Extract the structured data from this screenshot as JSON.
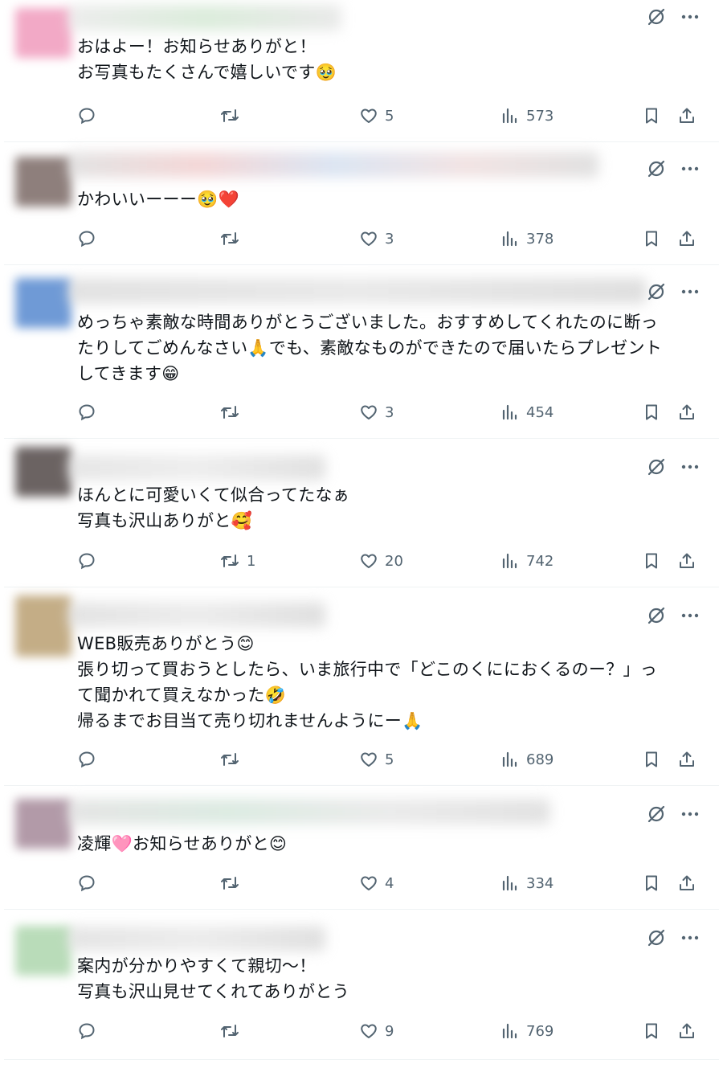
{
  "colors": {
    "icon": "#536471",
    "text": "#0f1419",
    "divider": "#eff3f4"
  },
  "icons": {
    "reply": "reply-icon",
    "repost": "repost-icon",
    "like": "heart-icon",
    "views": "views-icon",
    "bookmark": "bookmark-icon",
    "share": "share-icon",
    "grok": "grok-icon",
    "more": "more-icon"
  },
  "posts": [
    {
      "text": "おはよー！お知らせありがと！\nお写真もたくさんで嬉しいです🥹",
      "replies": "",
      "reposts": "",
      "likes": "5",
      "views": "573"
    },
    {
      "text": "かわいいーーー🥹❤️",
      "replies": "",
      "reposts": "",
      "likes": "3",
      "views": "378"
    },
    {
      "text": "めっちゃ素敵な時間ありがとうございました。おすすめしてくれたのに断っ\nたりしてごめんなさい🙏でも、素敵なものができたので届いたらプレゼント\nしてきます😁",
      "replies": "",
      "reposts": "",
      "likes": "3",
      "views": "454"
    },
    {
      "text": "ほんとに可愛いくて似合ってたなぁ\n写真も沢山ありがと🥰",
      "replies": "",
      "reposts": "1",
      "likes": "20",
      "views": "742"
    },
    {
      "text": "WEB販売ありがとう😊\n張り切って買おうとしたら、いま旅行中で「どこのくににおくるのー？」っ\nて聞かれて買えなかった🤣\n帰るまでお目当て売り切れませんようにー🙏",
      "replies": "",
      "reposts": "",
      "likes": "5",
      "views": "689"
    },
    {
      "text": "凌輝🩷お知らせありがと😊",
      "replies": "",
      "reposts": "",
      "likes": "4",
      "views": "334"
    },
    {
      "text": "案内が分かりやすくて親切〜！\n写真も沢山見せてくれてありがとう",
      "replies": "",
      "reposts": "",
      "likes": "9",
      "views": "769"
    }
  ]
}
